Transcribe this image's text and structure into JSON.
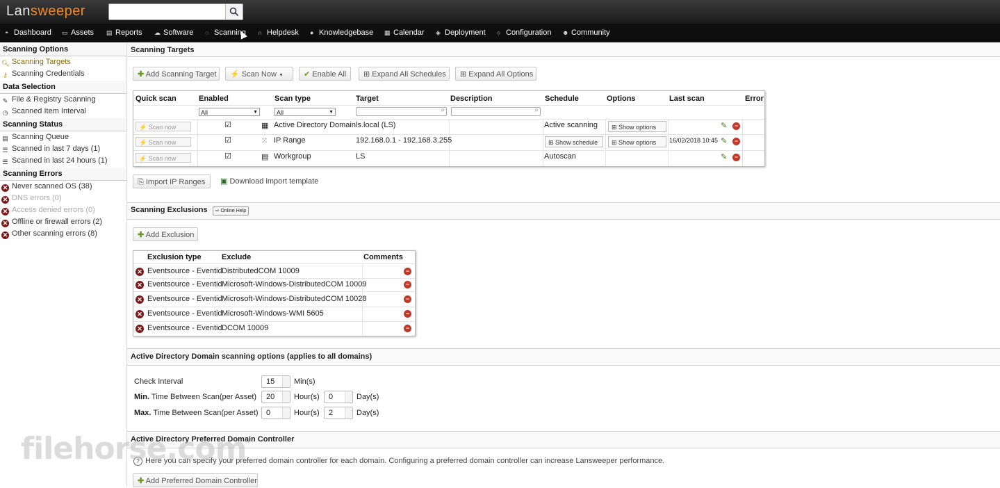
{
  "brand": {
    "logo_prefix": "Lan",
    "logo_suffix": "sweeper"
  },
  "search": {
    "value": "",
    "placeholder": ""
  },
  "nav": [
    {
      "label": "Dashboard",
      "icon": "dashboard-icon"
    },
    {
      "label": "Assets",
      "icon": "monitor-icon"
    },
    {
      "label": "Reports",
      "icon": "report-icon"
    },
    {
      "label": "Software",
      "icon": "software-icon"
    },
    {
      "label": "Scanning",
      "icon": "scanning-icon"
    },
    {
      "label": "Helpdesk",
      "icon": "headset-icon"
    },
    {
      "label": "Knowledgebase",
      "icon": "info-icon"
    },
    {
      "label": "Calendar",
      "icon": "calendar-icon"
    },
    {
      "label": "Deployment",
      "icon": "deployment-icon"
    },
    {
      "label": "Configuration",
      "icon": "config-icon"
    },
    {
      "label": "Community",
      "icon": "community-icon"
    }
  ],
  "sidebar": {
    "scanning_options_header": "Scanning Options",
    "scanning_targets": "Scanning Targets",
    "scanning_credentials": "Scanning Credentials",
    "data_selection_header": "Data Selection",
    "file_registry": "File & Registry Scanning",
    "scanned_item_interval": "Scanned Item Interval",
    "scanning_status_header": "Scanning Status",
    "scanning_queue": "Scanning Queue",
    "scanned_7_days": "Scanned in last 7 days (1)",
    "scanned_24_hours": "Scanned in last 24 hours (1)",
    "scanning_errors_header": "Scanning Errors",
    "errors": [
      {
        "label": "Never scanned OS (38)",
        "muted": false
      },
      {
        "label": "DNS errors (0)",
        "muted": true
      },
      {
        "label": "Access denied errors (0)",
        "muted": true
      },
      {
        "label": "Offline or firewall errors (2)",
        "muted": false
      },
      {
        "label": "Other scanning errors (8)",
        "muted": false
      }
    ]
  },
  "targets": {
    "section_title": "Scanning Targets",
    "add_button": "Add Scanning Target",
    "scan_now_button": "Scan Now",
    "enable_all_button": "Enable All",
    "expand_schedules_button": "Expand All Schedules",
    "expand_options_button": "Expand All Options",
    "columns": [
      "Quick scan",
      "Enabled",
      "Scan type",
      "Target",
      "Description",
      "Schedule",
      "Options",
      "Last scan",
      "Error"
    ],
    "filter_enabled": "All",
    "filter_scan_type": "All",
    "rows": [
      {
        "quick": "Scan now",
        "enabled": true,
        "type": "Active Directory Domain",
        "target": "ls.local (LS)",
        "description": "",
        "schedule": "Active scanning",
        "options": "Show options",
        "last_scan": ""
      },
      {
        "quick": "Scan now",
        "enabled": true,
        "type": "IP Range",
        "target": "192.168.0.1 - 192.168.3.255",
        "description": "",
        "schedule": "Show schedule",
        "options": "Show options",
        "last_scan": "16/02/2018 10:45"
      },
      {
        "quick": "Scan now",
        "enabled": true,
        "type": "Workgroup",
        "target": "LS",
        "description": "",
        "schedule": "Autoscan",
        "options": "",
        "last_scan": ""
      }
    ],
    "import_button": "Import IP Ranges",
    "download_template": "Download import template"
  },
  "exclusions": {
    "section_title": "Scanning Exclusions",
    "online_help": "Online Help",
    "add_button": "Add Exclusion",
    "columns": [
      "Exclusion type",
      "Exclude",
      "Comments"
    ],
    "rows": [
      {
        "type": "Eventsource - Eventid",
        "exclude": "DistributedCOM 10009",
        "comments": ""
      },
      {
        "type": "Eventsource - Eventid",
        "exclude": "Microsoft-Windows-DistributedCOM 10009",
        "comments": ""
      },
      {
        "type": "Eventsource - Eventid",
        "exclude": "Microsoft-Windows-DistributedCOM 10028",
        "comments": ""
      },
      {
        "type": "Eventsource - Eventid",
        "exclude": "Microsoft-Windows-WMI 5605",
        "comments": ""
      },
      {
        "type": "Eventsource - Eventid",
        "exclude": "DCOM 10009",
        "comments": ""
      }
    ]
  },
  "ad_options": {
    "section_title": "Active Directory Domain scanning options (applies to all domains)",
    "check_interval_label": "Check Interval",
    "check_interval_value": "15",
    "check_interval_unit": "Min(s)",
    "min_label_bold": "Min.",
    "min_label": "Time Between Scan(per Asset)",
    "min_hours": "20",
    "min_days": "0",
    "max_label_bold": "Max.",
    "max_label": "Time Between Scan(per Asset)",
    "max_hours": "0",
    "max_days": "2",
    "hours_unit": "Hour(s)",
    "days_unit": "Day(s)"
  },
  "preferred_dc": {
    "section_title": "Active Directory Preferred Domain Controller",
    "help_text": "Here you can specify your preferred domain controller for each domain. Configuring a preferred domain controller can increase Lansweeper performance.",
    "add_button": "Add Preferred Domain Controller"
  },
  "watermark": "filehorse.com"
}
